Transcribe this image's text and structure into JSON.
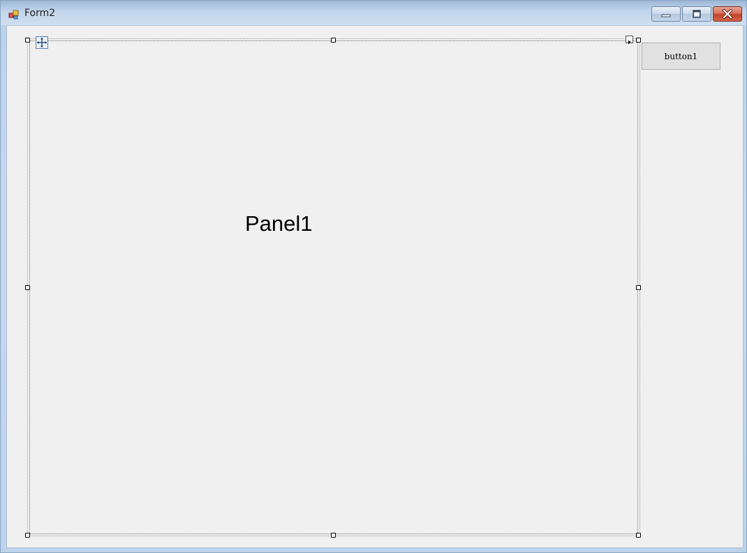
{
  "window": {
    "title": "Form2",
    "controls": {
      "minimize_icon": "minimize-icon",
      "maximize_icon": "maximize-icon",
      "close_icon": "close-icon"
    }
  },
  "designer": {
    "panel": {
      "label": "Panel1"
    },
    "button": {
      "label": "button1"
    }
  },
  "colors": {
    "client_background": "#f0f0f0",
    "title_bar": "#c3d6ec",
    "close_button": "#c2432b"
  }
}
